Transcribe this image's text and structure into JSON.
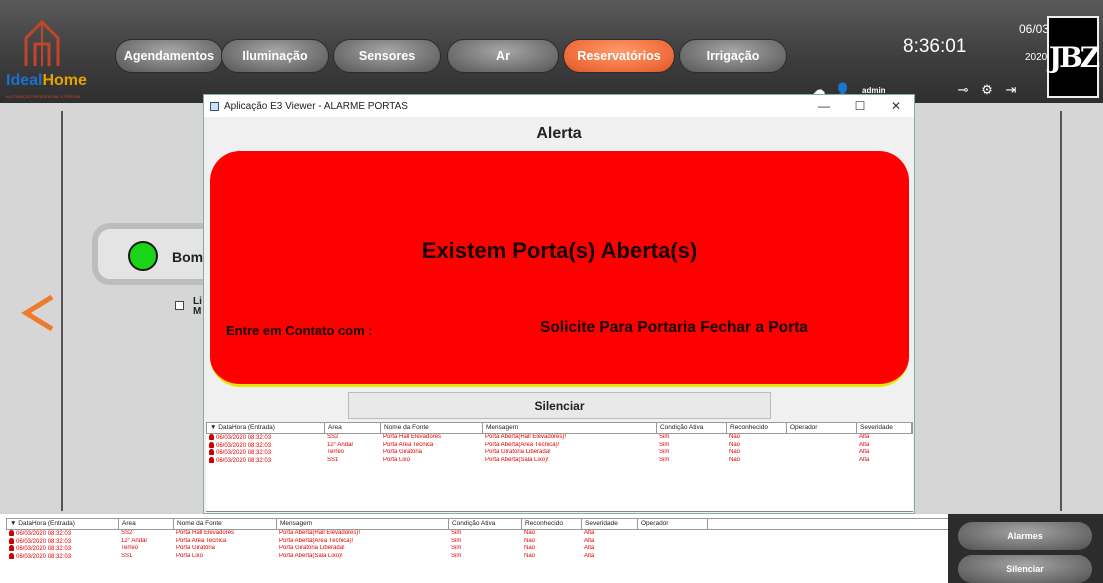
{
  "brand": {
    "logo_part1": "Ideal",
    "logo_part2": "Home",
    "logo_sub": "AUTOMAÇÃO RESIDENCIAL E PREDIAL"
  },
  "nav": [
    {
      "label": "Agendamentos",
      "active": false
    },
    {
      "label": "Iluminação",
      "active": false
    },
    {
      "label": "Sensores",
      "active": false
    },
    {
      "label": "Ar",
      "active": false
    },
    {
      "label": "Reservatórios",
      "active": true
    },
    {
      "label": "Irrigação",
      "active": false
    }
  ],
  "clock": {
    "time": "8:36:01",
    "day_month": "06/03",
    "year": "2020"
  },
  "jbz_logo": "JBZ",
  "user": {
    "name": "admin"
  },
  "pump": {
    "label": "Bom",
    "checkbox_label": "Li\nM"
  },
  "popup": {
    "title": "Aplicação E3 Viewer - ALARME PORTAS",
    "heading": "Alerta",
    "main_message": "Existem Porta(s) Aberta(s)",
    "contact_label": "Entre em Contato com :",
    "instruction": "Solicite Para Portaria Fechar a Porta",
    "silence_label": "Silenciar",
    "table": {
      "headers": [
        "▼ DataHora (Entrada)",
        "Area",
        "Nome da Fonte",
        "Mensagem",
        "Condição Ativa",
        "Reconhecido",
        "Operador",
        "Severidade"
      ],
      "rows": [
        [
          "06/03/2020 08:32:03",
          "SS2",
          "Porta Hall Elevadores",
          "Porta Aberta(Hall Elevadores)!",
          "Sim",
          "Não",
          "",
          "Alta"
        ],
        [
          "06/03/2020 08:32:03",
          "12° Andar",
          "Porta Area Tecnica",
          "Porta Aberta(Area Técnica)!",
          "Sim",
          "Não",
          "",
          "Alta"
        ],
        [
          "06/03/2020 08:32:03",
          "Terreo",
          "Porta Giratória",
          "Porta Giratória Liberada!",
          "Sim",
          "Não",
          "",
          "Alta"
        ],
        [
          "06/03/2020 08:32:03",
          "SS1",
          "Porta Lixo",
          "Porta Aberta(Sala Lixo)!",
          "Sim",
          "Não",
          "",
          "Alta"
        ]
      ]
    }
  },
  "bottom_table": {
    "headers": [
      "▼ DataHora (Entrada)",
      "Area",
      "Nome da Fonte",
      "Mensagem",
      "Condição Ativa",
      "Reconhecido",
      "Severidade",
      "Operador"
    ],
    "rows": [
      [
        "06/03/2020 08:32:03",
        "SS2",
        "Porta Hall Elevadores",
        "Porta Aberta(Hall Elevadores)!",
        "Sim",
        "Não",
        "Alta",
        ""
      ],
      [
        "06/03/2020 08:32:03",
        "12° Andar",
        "Porta Area Tecnica",
        "Porta Aberta(Area Técnica)!",
        "Sim",
        "Não",
        "Alta",
        ""
      ],
      [
        "06/03/2020 08:32:03",
        "Terreo",
        "Porta Giratória",
        "Porta Giratória Liberada!",
        "Sim",
        "Não",
        "Alta",
        ""
      ],
      [
        "06/03/2020 08:32:03",
        "SS1",
        "Porta Lixo",
        "Porta Aberta(Sala Lixo)!",
        "Sim",
        "Não",
        "Alta",
        ""
      ]
    ]
  },
  "side_buttons": {
    "alarms": "Alarmes",
    "silence": "Silenciar"
  },
  "colors": {
    "accent": "#ef6b3a",
    "alert_red": "#ff0000",
    "alarm_text": "#e00000",
    "pump_on": "#19d419"
  }
}
